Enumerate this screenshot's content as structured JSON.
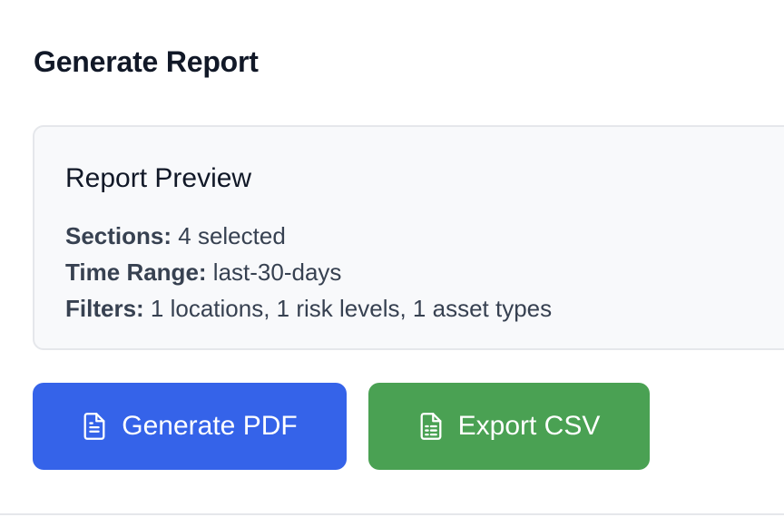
{
  "header": {
    "title": "Generate Report"
  },
  "preview": {
    "title": "Report Preview",
    "sections_label": "Sections:",
    "sections_value": "4 selected",
    "time_range_label": "Time Range:",
    "time_range_value": "last-30-days",
    "filters_label": "Filters:",
    "filters_value": "1 locations, 1 risk levels, 1 asset types"
  },
  "actions": {
    "generate_pdf_label": "Generate PDF",
    "generate_pdf_icon": "file-text-icon",
    "export_csv_label": "Export CSV",
    "export_csv_icon": "file-spreadsheet-icon"
  },
  "colors": {
    "primary": "#3563e9",
    "success": "#4aa153",
    "card_bg": "#f8f9fb",
    "card_border": "#e5e7eb"
  }
}
